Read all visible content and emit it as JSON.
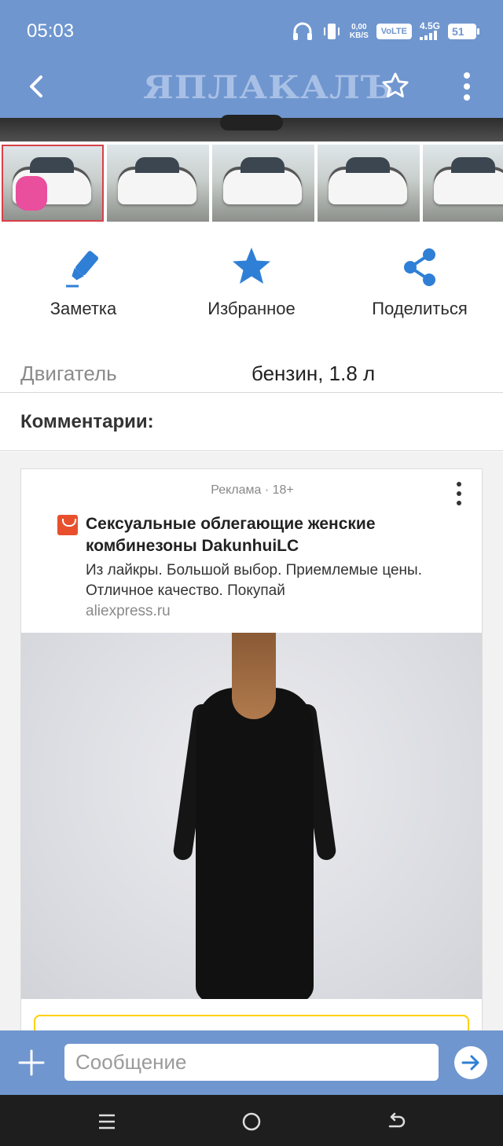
{
  "status_bar": {
    "time": "05:03",
    "data_speed": "0,00",
    "data_unit": "KB/S",
    "volte": "VoLTE",
    "network": "4.5G",
    "battery": "51"
  },
  "header": {
    "logo": "ЯПЛАКАЛЪ",
    "back_icon": "arrow-left-icon",
    "favorite_icon": "star-outline-icon",
    "menu_icon": "more-vert-icon"
  },
  "gallery": {
    "thumbnail_count": 5,
    "selected_index": 0
  },
  "actions": [
    {
      "label": "Заметка",
      "icon": "marker-icon"
    },
    {
      "label": "Избранное",
      "icon": "star-icon"
    },
    {
      "label": "Поделиться",
      "icon": "share-icon"
    }
  ],
  "spec": {
    "key": "Двигатель",
    "value": "бензин, 1.8 л"
  },
  "comments": {
    "title": "Комментарии:"
  },
  "ad": {
    "label": "Реклама · 18+",
    "title": "Сексуальные облегающие женские комбинезоны DakunhuiLC",
    "description": "Из лайкры. Большой выбор. Приемлемые цены. Отличное качество. Покупай",
    "domain": "aliexpress.ru"
  },
  "compose": {
    "placeholder": "Сообщение",
    "plus_icon": "plus-icon",
    "send_icon": "send-arrow-icon"
  },
  "system_nav": {
    "icons": [
      "recents-icon",
      "home-icon",
      "back-icon"
    ]
  },
  "colors": {
    "brand_blue": "#6f96cf",
    "action_blue": "#2f7fd6",
    "logo_text": "#a9c0e6",
    "selected_border": "#d8404a"
  }
}
